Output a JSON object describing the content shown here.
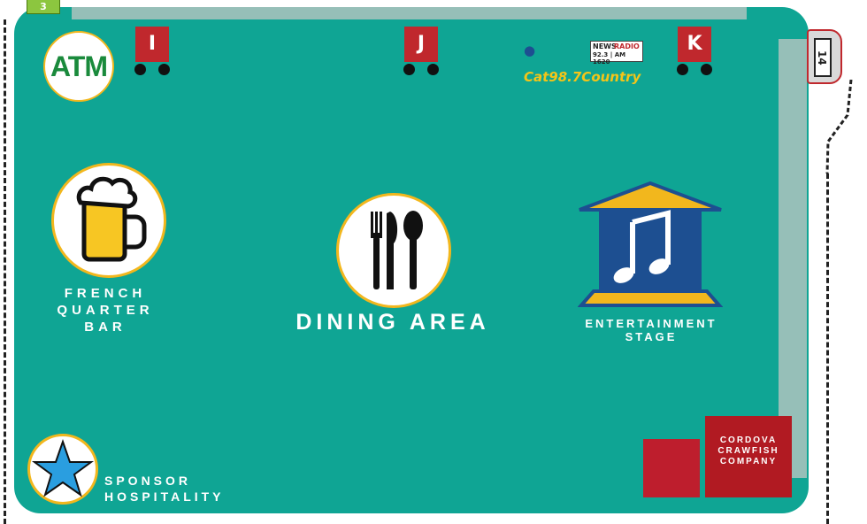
{
  "corner_tag": "3",
  "gate": {
    "number": "14"
  },
  "atm": {
    "label": "ATM"
  },
  "carts": [
    {
      "label": "I"
    },
    {
      "label": "J"
    },
    {
      "label": "K"
    }
  ],
  "sponsor_logos": {
    "cat_country": "Cat98.7Country",
    "news_radio_top": "NEWS",
    "news_radio_word": "RADIO",
    "news_radio_bottom": "92.3 | AM 1620"
  },
  "areas": {
    "bar": {
      "label": "FRENCH QUARTER BAR",
      "icon": "beer-mug-icon"
    },
    "dining": {
      "label": "DINING AREA",
      "icon": "utensils-icon"
    },
    "stage": {
      "label": "ENTERTAINMENT STAGE",
      "icon": "music-note-icon"
    },
    "sponsor": {
      "label": "SPONSOR HOSPITALITY",
      "icon": "star-icon"
    }
  },
  "vendor": {
    "label": "CORDOVA CRAWFISH COMPANY"
  },
  "colors": {
    "field": "#0fa594",
    "walkway": "#96bfb8",
    "accent_yellow": "#f2b71d",
    "vendor_red": "#b11a22",
    "stage_blue": "#1d4f91"
  }
}
